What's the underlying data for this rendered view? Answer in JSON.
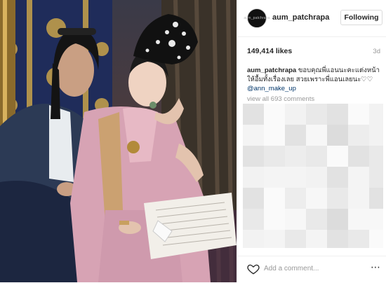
{
  "post": {
    "photo_alt": "",
    "photo_icons": [
      "woman-in-denim-jacket",
      "woman-in-pink-thai-dress",
      "ornate-headdress",
      "script-papers"
    ]
  },
  "header": {
    "avatar_text": "aum_patchrapa",
    "username": "aum_patchrapa",
    "follow_label": "Following"
  },
  "stats": {
    "likes": "149,414 likes",
    "time_ago": "3d"
  },
  "caption": {
    "username": "aum_patchrapa",
    "text": "ขอบคุณพี่แอนนะคะแต่งหน้าให้อื้มทั้งเรื่องเลย สวยเพราะพี่แอนเลยนะ♡♡",
    "mention": "@ann_make_up"
  },
  "comments": {
    "view_all": "view all 693 comments"
  },
  "footer": {
    "heart_icon": "heart-icon",
    "add_comment_placeholder": "Add a comment...",
    "more_label": "⋯"
  },
  "colors": {
    "border": "#efefef",
    "button_border": "#dbdbdb",
    "muted_text": "#999999",
    "mention_link": "#003569"
  }
}
